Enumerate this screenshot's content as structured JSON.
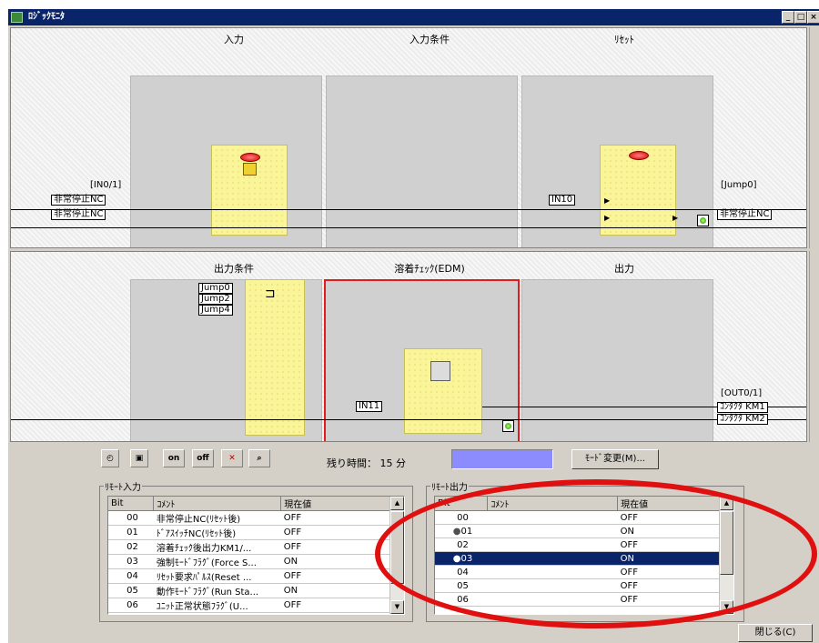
{
  "window": {
    "title": "ﾛｼﾞｯｸﾓﾆﾀ",
    "buttons": [
      "_",
      "□",
      "×"
    ]
  },
  "top_panel": {
    "columns": [
      "入力",
      "入力条件",
      "ﾘｾｯﾄ"
    ],
    "input_label": "[IN0/1]",
    "input_tags": [
      "非常停止NC",
      "非常停止NC"
    ],
    "reset_tag": "IN10",
    "output_label": "[Jump0]",
    "output_tag": "非常停止NC"
  },
  "mid_panel": {
    "columns": [
      "出力条件",
      "溶着ﾁｪｯｸ(EDM)",
      "出力"
    ],
    "jump_tags": [
      "Jump0",
      "Jump2",
      "Jump4"
    ],
    "edm_tag": "IN11",
    "output_label": "[OUT0/1]",
    "output_tags": [
      "ｺﾝﾀｸﾀ KM1",
      "ｺﾝﾀｸﾀ KM2"
    ]
  },
  "toolbar": {
    "icons": [
      "clock-icon",
      "lock-icon",
      "on-icon",
      "off-icon",
      "clear-icon",
      "search-icon"
    ],
    "on_text": "on",
    "off_text": "off",
    "remaining_label": "残り時間：",
    "remaining_value": "15 分",
    "mode_button": "ﾓｰﾄﾞ変更(M)..."
  },
  "remote_input": {
    "title": "ﾘﾓｰﾄ入力",
    "headers": [
      "Bit",
      "ｺﾒﾝﾄ",
      "現在値"
    ],
    "rows": [
      [
        "00",
        "非常停止NC(ﾘｾｯﾄ後)",
        "OFF"
      ],
      [
        "01",
        "ﾄﾞｱｽｲｯﾁNC(ﾘｾｯﾄ後)",
        "OFF"
      ],
      [
        "02",
        "溶着ﾁｪｯｸ後出力KM1/...",
        "OFF"
      ],
      [
        "03",
        "強制ﾓｰﾄﾞﾌﾗｸﾞ(Force S...",
        "ON"
      ],
      [
        "04",
        "ﾘｾｯﾄ要求ﾊﾟﾙｽ(Reset ...",
        "OFF"
      ],
      [
        "05",
        "動作ﾓｰﾄﾞﾌﾗｸﾞ(Run Sta...",
        "ON"
      ],
      [
        "06",
        "ﾕﾆｯﾄ正常状態ﾌﾗｸﾞ(U...",
        "OFF"
      ]
    ]
  },
  "remote_output": {
    "title": "ﾘﾓｰﾄ出力",
    "headers": [
      "Bit",
      "ｺﾒﾝﾄ",
      "現在値"
    ],
    "rows": [
      [
        "00",
        "",
        "OFF"
      ],
      [
        "01",
        "",
        "ON"
      ],
      [
        "02",
        "",
        "OFF"
      ],
      [
        "03",
        "",
        "ON"
      ],
      [
        "04",
        "",
        "OFF"
      ],
      [
        "05",
        "",
        "OFF"
      ],
      [
        "06",
        "",
        "OFF"
      ]
    ],
    "selected_row": 3
  },
  "close_button": "閉じる(C)",
  "colors": {
    "highlight": "#0a246a",
    "red_annotation": "#e01010",
    "yellow_block": "#fbf59a",
    "timer_bar": "#8c8cff"
  }
}
